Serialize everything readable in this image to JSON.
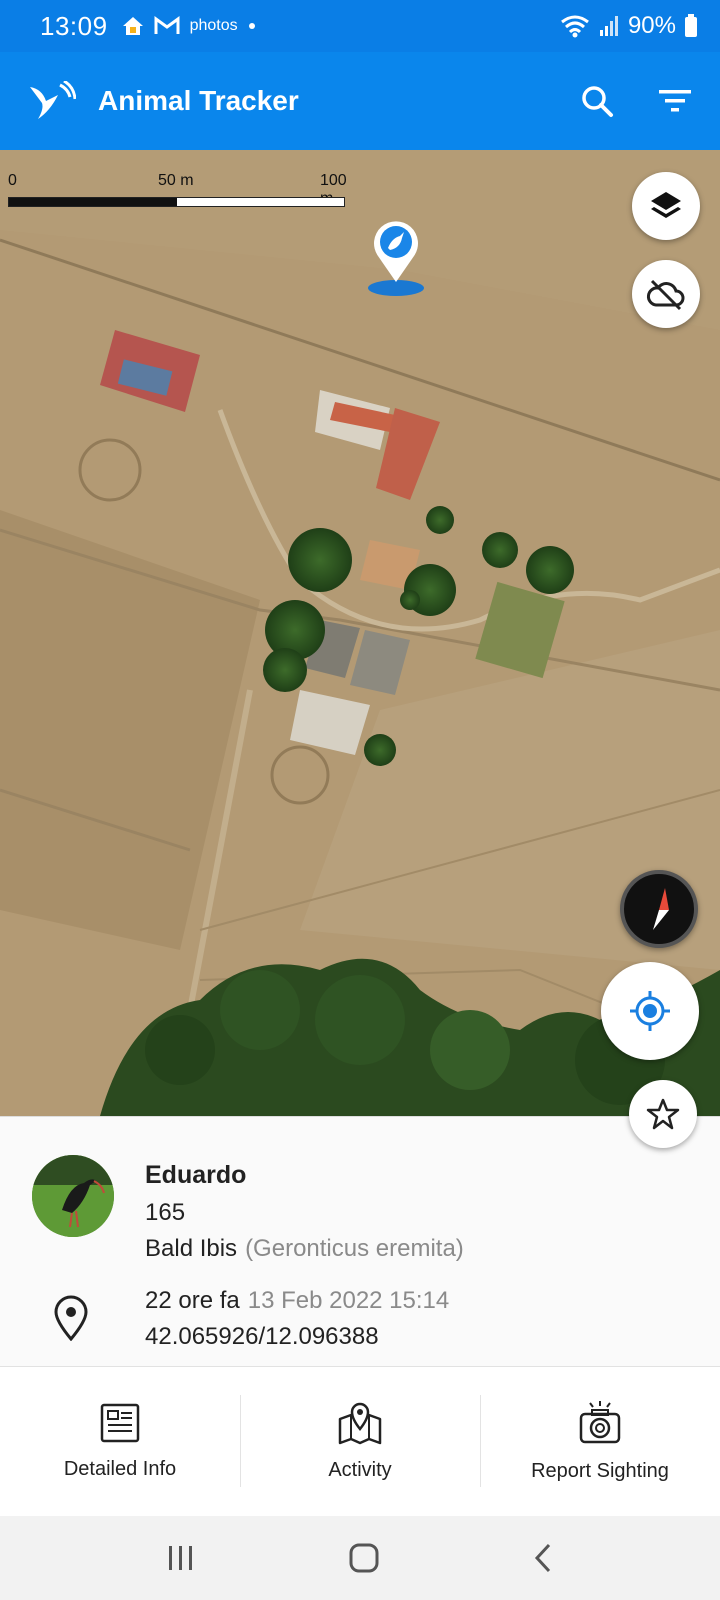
{
  "status_bar": {
    "time": "13:09",
    "notification_icons": [
      "home-icon",
      "gmail-icon",
      "photos-icon",
      "dot-icon"
    ],
    "photos_label": "photos",
    "battery": "90%"
  },
  "app_bar": {
    "title": "Animal Tracker",
    "actions": [
      "search-icon",
      "filter-icon"
    ],
    "color": "#0a86ec"
  },
  "map": {
    "scale_labels": [
      "0",
      "50 m",
      "100 m"
    ],
    "controls": [
      "layers-icon",
      "cloud-off-icon",
      "compass-icon",
      "my-location-icon",
      "star-icon"
    ],
    "marker": "bird-marker-icon"
  },
  "animal": {
    "name": "Eduardo",
    "id": "165",
    "common_name": "Bald Ibis",
    "scientific_name": "(Geronticus eremita)",
    "last_seen_relative": "22 ore fa",
    "last_seen_date": "13 Feb 2022 15:14",
    "coordinates": "42.065926/12.096388"
  },
  "actions": [
    {
      "label": "Detailed Info",
      "icon": "detailed-info-icon"
    },
    {
      "label": "Activity",
      "icon": "activity-map-icon"
    },
    {
      "label": "Report Sighting",
      "icon": "camera-icon"
    }
  ],
  "nav_bar": [
    "recent-apps-icon",
    "home-button-icon",
    "back-icon"
  ]
}
